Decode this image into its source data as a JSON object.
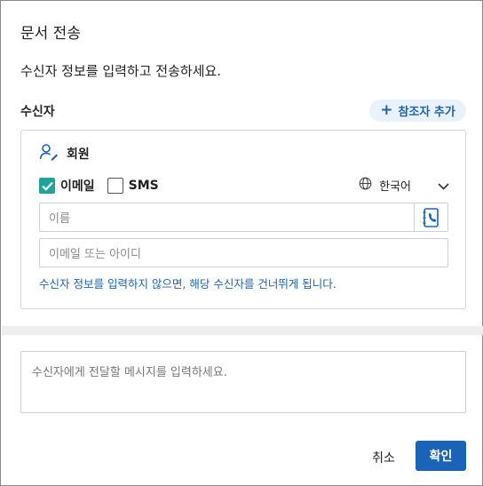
{
  "dialog": {
    "title": "문서 전송",
    "subtitle": "수신자 정보를 입력하고 전송하세요."
  },
  "recipients": {
    "section_label": "수신자",
    "add_reference_label": "참조자 추가",
    "card": {
      "member_label": "회원",
      "options": [
        {
          "label": "이메일",
          "checked": true
        },
        {
          "label": "SMS",
          "checked": false
        }
      ],
      "language": {
        "selected": "한국어"
      },
      "name_input": {
        "placeholder": "이름",
        "value": ""
      },
      "email_input": {
        "placeholder": "이메일 또는 아이디",
        "value": ""
      },
      "hint": "수신자 정보를 입력하지 않으면, 해당 수신자를 건너뛰게 됩니다."
    }
  },
  "message": {
    "placeholder": "수신자에게 전달할 메시지를 입력하세요.",
    "value": ""
  },
  "footer": {
    "cancel_label": "취소",
    "confirm_label": "확인"
  },
  "colors": {
    "accent": "#1b63b6",
    "check_on": "#1fa39a",
    "pill_bg": "#e9f2fb"
  }
}
